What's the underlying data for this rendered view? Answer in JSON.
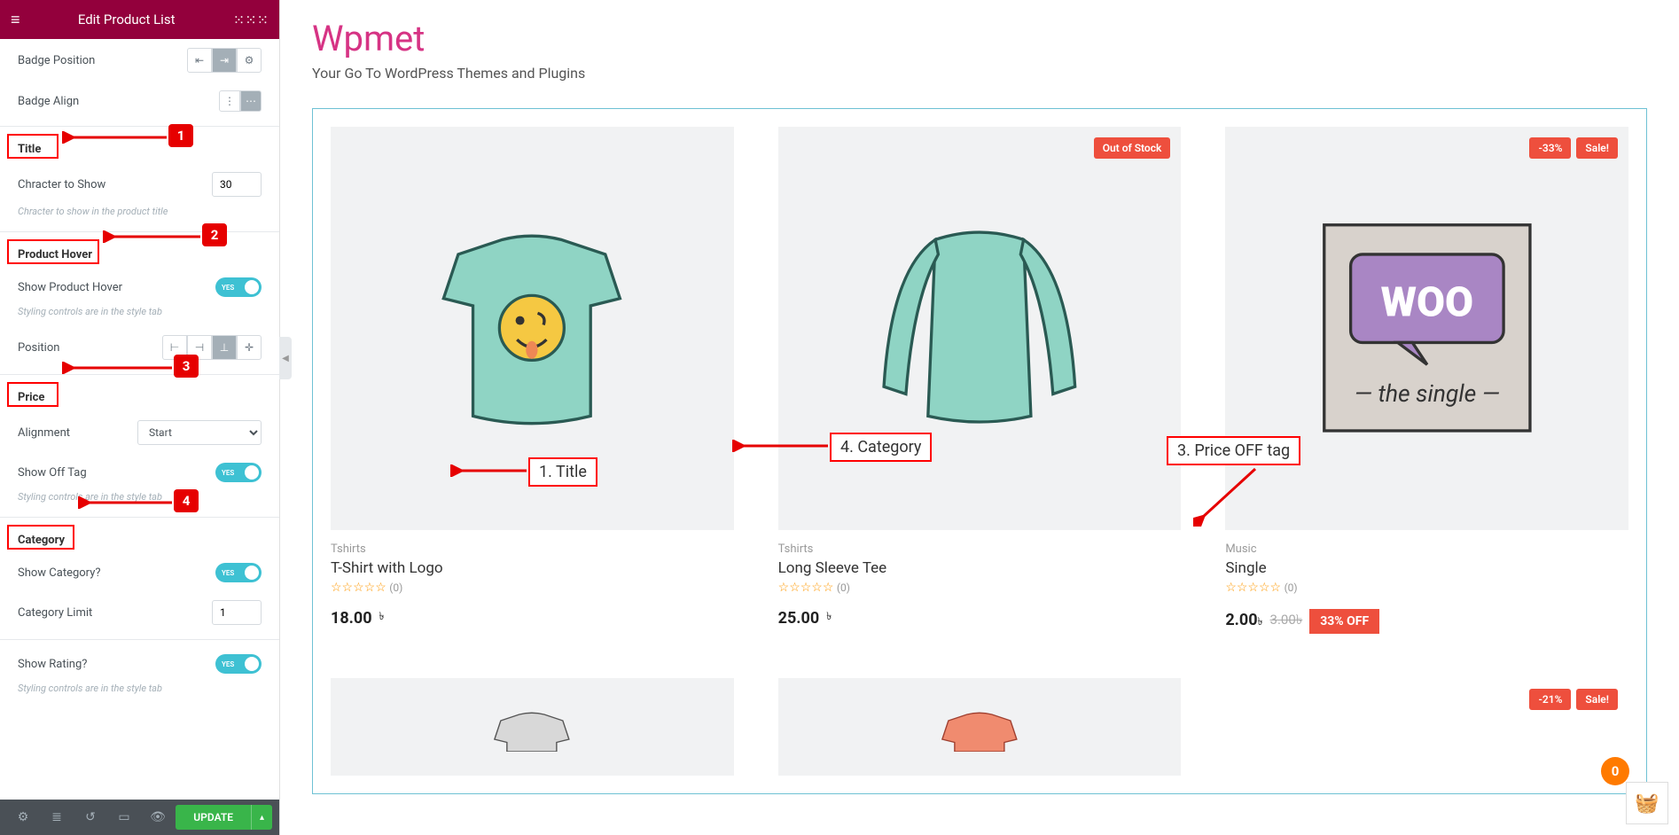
{
  "sidebar": {
    "header_title": "Edit Product List",
    "controls": {
      "badge_position_label": "Badge Position",
      "badge_align_label": "Badge Align",
      "title_section": "Title",
      "chracter_to_show_label": "Chracter to Show",
      "chracter_to_show_value": "30",
      "chracter_help": "Chracter to show in the product title",
      "product_hover_section": "Product Hover",
      "show_product_hover_label": "Show Product Hover",
      "show_product_hover_value": "YES",
      "style_help": "Styling controls are in the style tab",
      "position_label": "Position",
      "price_section": "Price",
      "alignment_label": "Alignment",
      "alignment_value": "Start",
      "show_off_tag_label": "Show Off Tag",
      "show_off_tag_value": "YES",
      "category_section": "Category",
      "show_category_label": "Show Category?",
      "show_category_value": "YES",
      "category_limit_label": "Category Limit",
      "category_limit_value": "1",
      "show_rating_label": "Show Rating?",
      "show_rating_value": "YES"
    },
    "footer": {
      "update_label": "UPDATE"
    }
  },
  "main": {
    "title": "Wpmet",
    "subtitle": "Your Go To WordPress Themes and Plugins"
  },
  "products": [
    {
      "badges": [],
      "category": "Tshirts",
      "title": "T-Shirt with Logo",
      "rating_count": "(0)",
      "price": "18.00",
      "currency": "৳",
      "old_price": "",
      "off_tag": ""
    },
    {
      "badges": [
        "Out of Stock"
      ],
      "category": "Tshirts",
      "title": "Long Sleeve Tee",
      "rating_count": "(0)",
      "price": "25.00",
      "currency": "৳",
      "old_price": "",
      "off_tag": ""
    },
    {
      "badges": [
        "-33%",
        "Sale!"
      ],
      "category": "Music",
      "title": "Single",
      "rating_count": "(0)",
      "price": "2.00",
      "currency": "৳",
      "old_price": "3.00৳",
      "off_tag": "33% OFF"
    }
  ],
  "row2_badges": [
    "-21%",
    "Sale!"
  ],
  "annotations": {
    "n1": "1",
    "n2": "2",
    "n3": "3",
    "n4": "4",
    "title_label": "1. Title",
    "category_label": "4. Category",
    "price_off_label": "3. Price OFF tag"
  },
  "fab": {
    "count": "0"
  }
}
